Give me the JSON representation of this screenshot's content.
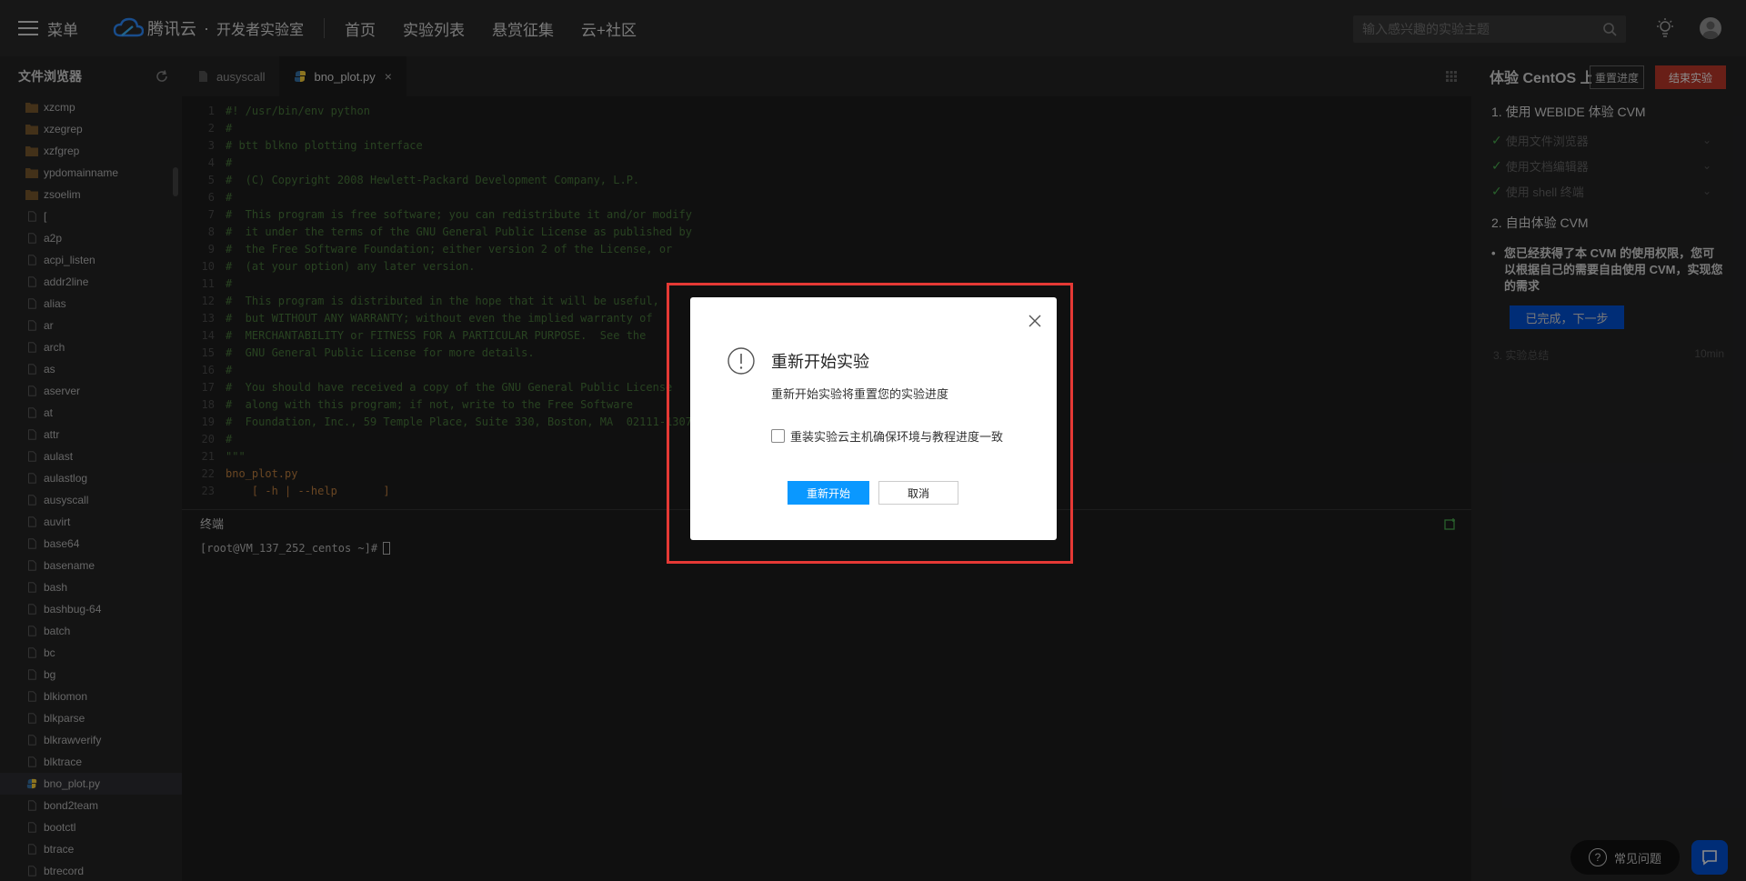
{
  "topbar": {
    "menu_label": "菜单",
    "brand_name": "腾讯云",
    "brand_dot": "·",
    "brand_sub": "开发者实验室",
    "nav": [
      "首页",
      "实验列表",
      "悬赏征集",
      "云+社区"
    ],
    "search_placeholder": "输入感兴趣的实验主题"
  },
  "sidebar": {
    "title": "文件浏览器",
    "files": [
      {
        "name": "xzcmp",
        "type": "folder"
      },
      {
        "name": "xzegrep",
        "type": "folder"
      },
      {
        "name": "xzfgrep",
        "type": "folder"
      },
      {
        "name": "ypdomainname",
        "type": "folder"
      },
      {
        "name": "zsoelim",
        "type": "folder"
      },
      {
        "name": "[",
        "type": "file"
      },
      {
        "name": "a2p",
        "type": "file"
      },
      {
        "name": "acpi_listen",
        "type": "file"
      },
      {
        "name": "addr2line",
        "type": "file"
      },
      {
        "name": "alias",
        "type": "file"
      },
      {
        "name": "ar",
        "type": "file"
      },
      {
        "name": "arch",
        "type": "file"
      },
      {
        "name": "as",
        "type": "file"
      },
      {
        "name": "aserver",
        "type": "file"
      },
      {
        "name": "at",
        "type": "file"
      },
      {
        "name": "attr",
        "type": "file"
      },
      {
        "name": "aulast",
        "type": "file"
      },
      {
        "name": "aulastlog",
        "type": "file"
      },
      {
        "name": "ausyscall",
        "type": "file"
      },
      {
        "name": "auvirt",
        "type": "file"
      },
      {
        "name": "base64",
        "type": "file"
      },
      {
        "name": "basename",
        "type": "file"
      },
      {
        "name": "bash",
        "type": "file"
      },
      {
        "name": "bashbug-64",
        "type": "file"
      },
      {
        "name": "batch",
        "type": "file"
      },
      {
        "name": "bc",
        "type": "file"
      },
      {
        "name": "bg",
        "type": "file"
      },
      {
        "name": "blkiomon",
        "type": "file"
      },
      {
        "name": "blkparse",
        "type": "file"
      },
      {
        "name": "blkrawverify",
        "type": "file"
      },
      {
        "name": "blktrace",
        "type": "file"
      },
      {
        "name": "bno_plot.py",
        "type": "python",
        "active": true
      },
      {
        "name": "bond2team",
        "type": "file"
      },
      {
        "name": "bootctl",
        "type": "file"
      },
      {
        "name": "btrace",
        "type": "file"
      },
      {
        "name": "btrecord",
        "type": "file"
      }
    ]
  },
  "editor": {
    "tabs": [
      {
        "label": "ausyscall",
        "active": false
      },
      {
        "label": "bno_plot.py",
        "active": true
      }
    ],
    "lines": [
      {
        "n": "1",
        "text": "#! /usr/bin/env python",
        "kind": "comment"
      },
      {
        "n": "2",
        "text": "#",
        "kind": "comment"
      },
      {
        "n": "3",
        "text": "# btt blkno plotting interface",
        "kind": "comment"
      },
      {
        "n": "4",
        "text": "#",
        "kind": "comment"
      },
      {
        "n": "5",
        "text": "#  (C) Copyright 2008 Hewlett-Packard Development Company, L.P.",
        "kind": "comment"
      },
      {
        "n": "6",
        "text": "#",
        "kind": "comment"
      },
      {
        "n": "7",
        "text": "#  This program is free software; you can redistribute it and/or modify",
        "kind": "comment"
      },
      {
        "n": "8",
        "text": "#  it under the terms of the GNU General Public License as published by",
        "kind": "comment"
      },
      {
        "n": "9",
        "text": "#  the Free Software Foundation; either version 2 of the License, or",
        "kind": "comment"
      },
      {
        "n": "10",
        "text": "#  (at your option) any later version.",
        "kind": "comment"
      },
      {
        "n": "11",
        "text": "#",
        "kind": "comment"
      },
      {
        "n": "12",
        "text": "#  This program is distributed in the hope that it will be useful,",
        "kind": "comment"
      },
      {
        "n": "13",
        "text": "#  but WITHOUT ANY WARRANTY; without even the implied warranty of",
        "kind": "comment"
      },
      {
        "n": "14",
        "text": "#  MERCHANTABILITY or FITNESS FOR A PARTICULAR PURPOSE.  See the",
        "kind": "comment"
      },
      {
        "n": "15",
        "text": "#  GNU General Public License for more details.",
        "kind": "comment"
      },
      {
        "n": "16",
        "text": "#",
        "kind": "comment"
      },
      {
        "n": "17",
        "text": "#  You should have received a copy of the GNU General Public License",
        "kind": "comment"
      },
      {
        "n": "18",
        "text": "#  along with this program; if not, write to the Free Software",
        "kind": "comment"
      },
      {
        "n": "19",
        "text": "#  Foundation, Inc., 59 Temple Place, Suite 330, Boston, MA  02111-1307",
        "kind": "comment"
      },
      {
        "n": "20",
        "text": "#",
        "kind": "comment"
      },
      {
        "n": "21",
        "text": "\"\"\"",
        "kind": "comment"
      },
      {
        "n": "22",
        "text": "bno_plot.py",
        "kind": "string"
      },
      {
        "n": "23",
        "text": "    [ -h | --help       ]",
        "kind": "string"
      }
    ]
  },
  "terminal": {
    "title": "终端",
    "prompt": "[root@VM_137_252_centos ~]#"
  },
  "rpanel": {
    "title": "体验 CentOS 上",
    "reset_label": "重置进度",
    "end_label": "结束实验",
    "section1": "1. 使用 WEBIDE 体验 CVM",
    "steps": [
      "使用文件浏览器",
      "使用文档编辑器",
      "使用 shell 终端"
    ],
    "section2": "2. 自由体验 CVM",
    "bullet": "您已经获得了本 CVM 的使用权限，您可以根据自己的需要自由使用 CVM，实现您的需求",
    "next_label": "已完成，下一步",
    "meta_left": "3. 实验总结",
    "meta_right": "10min",
    "faq_label": "常见问题"
  },
  "modal": {
    "title": "重新开始实验",
    "desc": "重新开始实验将重置您的实验进度",
    "checkbox_label": "重装实验云主机确保环境与教程进度一致",
    "confirm_label": "重新开始",
    "cancel_label": "取消"
  },
  "colors": {
    "accent": "#0a98ff",
    "danger": "#c0392b",
    "highlight": "#e53935"
  }
}
